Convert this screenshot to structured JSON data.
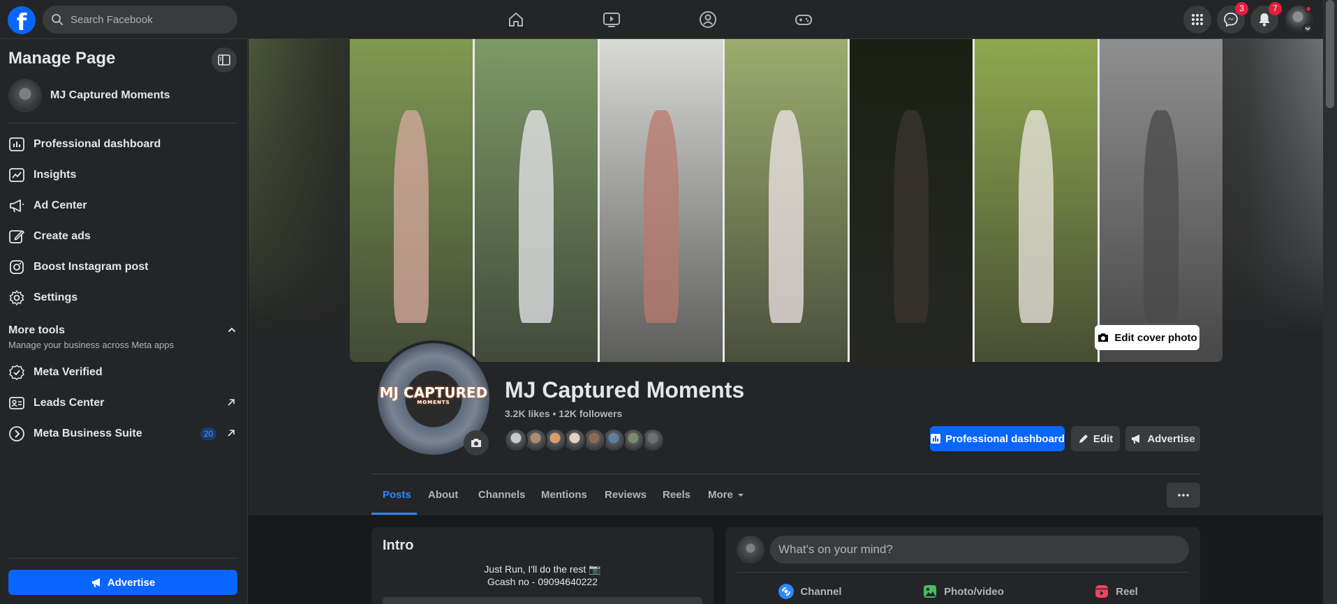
{
  "topbar": {
    "logo_letter": "f",
    "search": {
      "placeholder": "Search Facebook",
      "value": ""
    },
    "nav_icons": [
      "home-icon",
      "video-icon",
      "groups-icon",
      "gaming-icon"
    ],
    "messenger_badge": "3",
    "notifications_badge": "7"
  },
  "sidebar": {
    "title": "Manage Page",
    "page_name": "MJ Captured Moments",
    "items": [
      {
        "label": "Professional dashboard",
        "icon": "dashboard-icon"
      },
      {
        "label": "Insights",
        "icon": "insights-icon"
      },
      {
        "label": "Ad Center",
        "icon": "megaphone-icon"
      },
      {
        "label": "Create ads",
        "icon": "pencil-icon"
      },
      {
        "label": "Boost Instagram post",
        "icon": "instagram-icon"
      },
      {
        "label": "Settings",
        "icon": "gear-icon"
      }
    ],
    "more_tools": {
      "heading": "More tools",
      "subtitle": "Manage your business across Meta apps",
      "items": [
        {
          "label": "Meta Verified",
          "icon": "verified-icon",
          "external": false
        },
        {
          "label": "Leads Center",
          "icon": "leads-icon",
          "external": true
        },
        {
          "label": "Meta Business Suite",
          "icon": "business-suite-icon",
          "external": true,
          "count": "20"
        }
      ]
    },
    "advertise_label": "Advertise"
  },
  "cover": {
    "edit_label": "Edit cover photo",
    "panel_colors": [
      "#7f9a52",
      "#7c9a66",
      "#d9dad6",
      "#9cad6e",
      "#1b2014",
      "#90a84e",
      "#8f8f8f"
    ]
  },
  "profile": {
    "avatar_logo_title": "MJ CAPTURED",
    "avatar_logo_sub": "MOMENTS",
    "name": "MJ Captured Moments",
    "stats": "3.2K likes • 12K followers",
    "follower_avatar_colors": [
      "#c7c9cc",
      "#b08b73",
      "#d8a06a",
      "#e4d1c2",
      "#8a6a52",
      "#5e7ea0",
      "#7a8c6e",
      "#6f6f6f"
    ],
    "buttons": {
      "professional_dashboard": "Professional dashboard",
      "edit": "Edit",
      "advertise": "Advertise"
    }
  },
  "tabs": [
    {
      "label": "Posts",
      "active": true
    },
    {
      "label": "About",
      "active": false
    },
    {
      "label": "Channels",
      "active": false
    },
    {
      "label": "Mentions",
      "active": false
    },
    {
      "label": "Reviews",
      "active": false
    },
    {
      "label": "Reels",
      "active": false
    },
    {
      "label": "More",
      "active": false
    }
  ],
  "intro": {
    "title": "Intro",
    "lines": [
      "Just Run, I'll do the rest 📷",
      "Gcash no - 09094640222"
    ]
  },
  "composer": {
    "placeholder": "What's on your mind?",
    "actions": [
      {
        "label": "Channel",
        "icon": "channel-icon",
        "color": "#2d88ff"
      },
      {
        "label": "Photo/video",
        "icon": "photo-icon",
        "color": "#45bd62"
      },
      {
        "label": "Reel",
        "icon": "reel-icon",
        "color": "#f3425f"
      }
    ]
  },
  "colors": {
    "accent": "#0866ff",
    "link": "#2d88ff",
    "badge": "#e41e3f",
    "surface": "#242526",
    "background": "#18191a"
  }
}
